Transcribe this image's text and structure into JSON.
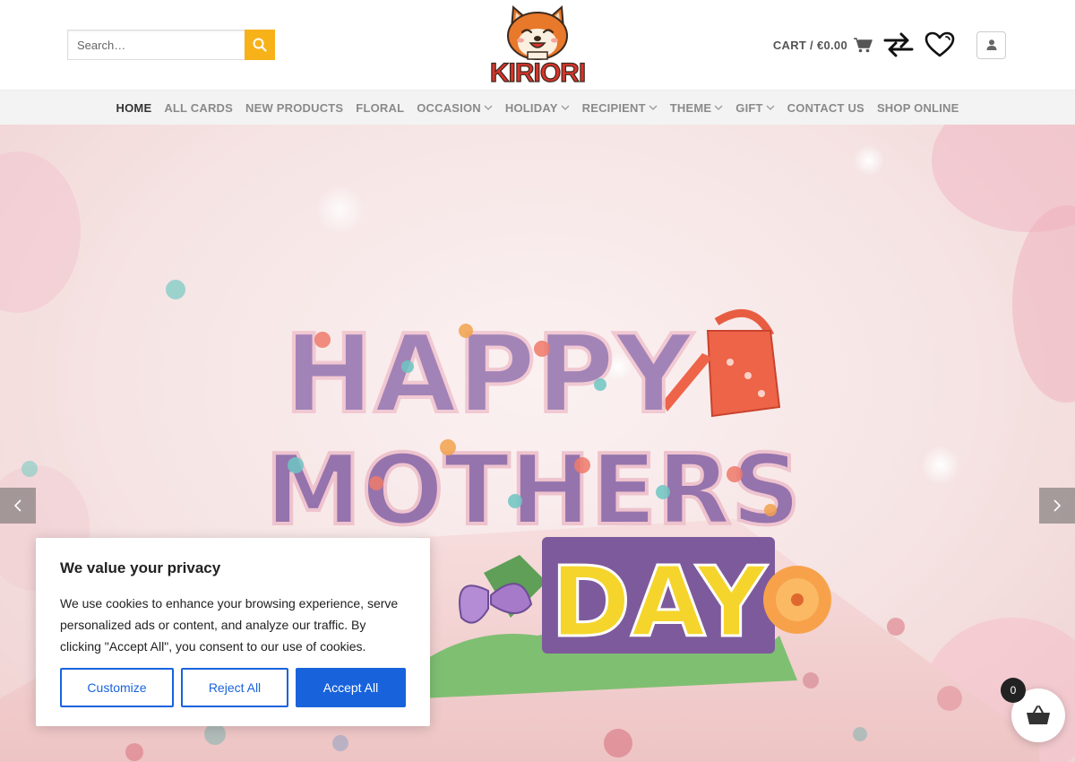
{
  "search": {
    "placeholder": "Search…"
  },
  "logo": {
    "text": "KIRIORI",
    "icon": "shiba-dog-logo"
  },
  "cart": {
    "label": "CART /",
    "amount": "€0.00"
  },
  "icons": {
    "search": "search-icon",
    "cart": "cart-icon",
    "compare": "compare-icon",
    "wishlist": "heart-icon",
    "account": "user-icon"
  },
  "nav": {
    "items": [
      {
        "label": "HOME",
        "active": true,
        "dropdown": false
      },
      {
        "label": "ALL CARDS",
        "dropdown": false
      },
      {
        "label": "NEW PRODUCTS",
        "dropdown": false
      },
      {
        "label": "FLORAL",
        "dropdown": false
      },
      {
        "label": "OCCASION",
        "dropdown": true
      },
      {
        "label": "HOLIDAY",
        "dropdown": true
      },
      {
        "label": "RECIPIENT",
        "dropdown": true
      },
      {
        "label": "THEME",
        "dropdown": true
      },
      {
        "label": "GIFT",
        "dropdown": true
      },
      {
        "label": "CONTACT US",
        "dropdown": false
      },
      {
        "label": "SHOP ONLINE",
        "dropdown": false
      }
    ]
  },
  "hero": {
    "line1": "HAPPY",
    "line2": "MOTHERS",
    "line3": "DAY"
  },
  "cookie": {
    "title": "We value your privacy",
    "text": "We use cookies to enhance your browsing experience, serve personalized ads or content, and analyze our traffic. By clicking \"Accept All\", you consent to our use of cookies.",
    "customize": "Customize",
    "reject": "Reject All",
    "accept": "Accept All"
  },
  "floating_cart": {
    "count": "0"
  },
  "colors": {
    "search_button": "#f7b21a",
    "cookie_blue": "#1863dc",
    "logo_orange": "#e8782a",
    "logo_red": "#d8342b"
  }
}
